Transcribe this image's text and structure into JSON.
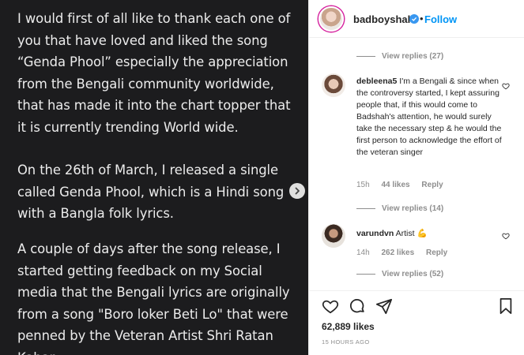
{
  "post": {
    "paragraphs": [
      "I would first of all like to thank each one of\nyou that have loved and liked the song\n“Genda Phool” especially the appreciation\nfrom the Bengali community worldwide,\nthat has made it into the chart topper that\nit is currently trending World wide.",
      "On the 26th of March, I released a single\ncalled Genda Phool, which is a Hindi song\nwith a Bangla folk lyrics.",
      "A couple of days after the song release, I\nstarted getting feedback on my Social\nmedia that the Bengali lyrics are originally\nfrom a song \"Boro loker Beti Lo\" that were\npenned by the Veteran Artist Shri Ratan\nKahar."
    ]
  },
  "header": {
    "username": "badboyshah",
    "separator": "•",
    "follow_label": "Follow"
  },
  "comments": {
    "top_view_replies": "View replies (27)",
    "items": [
      {
        "username": "debleena5",
        "text": "I'm a Bengali & since when the controversy started, I kept assuring people that, if this would come to Badshah's attention, he would surely take the necessary step & he would the first person to acknowledge the effort of the veteran singer",
        "time": "15h",
        "likes": "44 likes",
        "reply_label": "Reply",
        "view_replies": "View replies (14)"
      },
      {
        "username": "varundvn",
        "text": "Artist",
        "emoji": "💪",
        "time": "14h",
        "likes": "262 likes",
        "reply_label": "Reply",
        "view_replies": "View replies (52)"
      }
    ]
  },
  "actions": {
    "likes": "62,889 likes",
    "timestamp": "15 HOURS AGO"
  },
  "colors": {
    "post_bg": "#1c1c1e",
    "accent": "#0095f6",
    "muted": "#8e8e8e"
  }
}
